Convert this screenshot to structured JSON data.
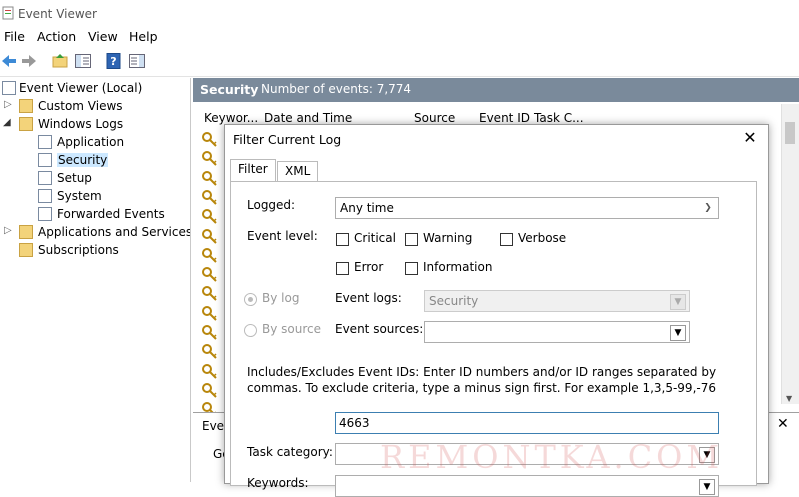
{
  "window": {
    "title": "Event Viewer"
  },
  "menu": [
    "File",
    "Action",
    "View",
    "Help"
  ],
  "tree": {
    "root": "Event Viewer (Local)",
    "custom_views": "Custom Views",
    "windows_logs": "Windows Logs",
    "application": "Application",
    "security": "Security",
    "setup": "Setup",
    "system": "System",
    "forwarded": "Forwarded Events",
    "apps_services": "Applications and Services Lo",
    "subscriptions": "Subscriptions"
  },
  "log": {
    "name": "Security",
    "count": "Number of events: 7,774",
    "columns": [
      "Keywor...",
      "Date and Time",
      "Source",
      "Event ID",
      "Task C..."
    ]
  },
  "detail": {
    "label1": "Even",
    "label2": "Ge"
  },
  "dialog": {
    "title": "Filter Current Log",
    "tabs": [
      "Filter",
      "XML"
    ],
    "logged_label": "Logged:",
    "logged_value": "Any time",
    "event_level_label": "Event level:",
    "levels": [
      "Critical",
      "Warning",
      "Verbose",
      "Error",
      "Information"
    ],
    "by_log": "By log",
    "by_source": "By source",
    "event_logs_label": "Event logs:",
    "event_logs_value": "Security",
    "event_sources_label": "Event sources:",
    "ids_help": "Includes/Excludes Event IDs: Enter ID numbers and/or ID ranges separated by commas. To exclude criteria, type a minus sign first. For example 1,3,5-99,-76",
    "event_id_value": "4663",
    "task_category_label": "Task category:",
    "keywords_label": "Keywords:"
  },
  "watermark": "REMONTKA.COM",
  "colors": {
    "header_bg": "#7a8a9b",
    "selection": "#cce8ff",
    "input_border": "#3c7fb1"
  }
}
